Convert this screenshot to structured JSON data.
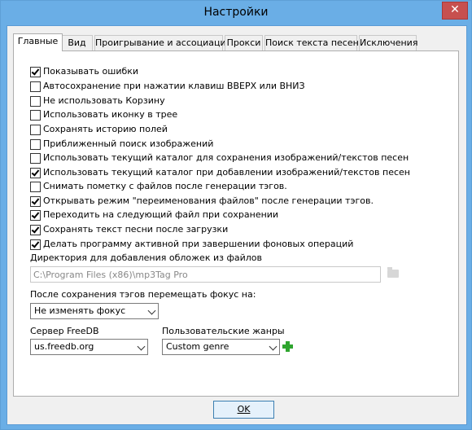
{
  "window": {
    "title": "Настройки",
    "close_glyph": "✕"
  },
  "tabs": [
    {
      "label": "Главные",
      "active": true
    },
    {
      "label": "Вид",
      "active": false
    },
    {
      "label": "Проигрывание и ассоциация",
      "active": false
    },
    {
      "label": "Прокси",
      "active": false
    },
    {
      "label": "Поиск текста песен",
      "active": false
    },
    {
      "label": "Исключения",
      "active": false
    }
  ],
  "options": [
    {
      "label": "Показывать ошибки",
      "checked": true
    },
    {
      "label": "Автосохранение при нажатии клавиш ВВЕРХ или ВНИЗ",
      "checked": false
    },
    {
      "label": "Не использовать Корзину",
      "checked": false
    },
    {
      "label": "Использовать иконку в трее",
      "checked": false
    },
    {
      "label": "Сохранять историю полей",
      "checked": false
    },
    {
      "label": "Приближенный поиск изображений",
      "checked": false
    },
    {
      "label": "Использовать текущий каталог для сохранения изображений/текстов песен",
      "checked": false
    },
    {
      "label": "Использовать текущий каталог при добавлении изображений/текстов песен",
      "checked": true
    },
    {
      "label": "Снимать пометку с файлов после генерации тэгов.",
      "checked": false
    },
    {
      "label": "Открывать режим \"переименования файлов\" после генерации тэгов.",
      "checked": true
    },
    {
      "label": "Переходить на следующий файл при сохранении",
      "checked": true
    },
    {
      "label": "Сохранять текст песни после загрузки",
      "checked": true
    },
    {
      "label": "Делать программу активной при завершении фоновых операций",
      "checked": true
    }
  ],
  "cover_dir": {
    "label": "Директория для добавления обложек из файлов",
    "value": "C:\\Program Files (x86)\\mp3Tag Pro"
  },
  "focus": {
    "label": "После сохранения тэгов перемещать фокус на:",
    "value": "Не изменять фокус"
  },
  "freedb": {
    "label": "Сервер FreeDB",
    "value": "us.freedb.org"
  },
  "genres": {
    "label": "Пользовательские жанры",
    "value": "Custom genre"
  },
  "ok_label": "OK",
  "colors": {
    "title_bar": "#6aaee6",
    "close_button": "#c7504f",
    "add_icon": "#2fa52f"
  }
}
